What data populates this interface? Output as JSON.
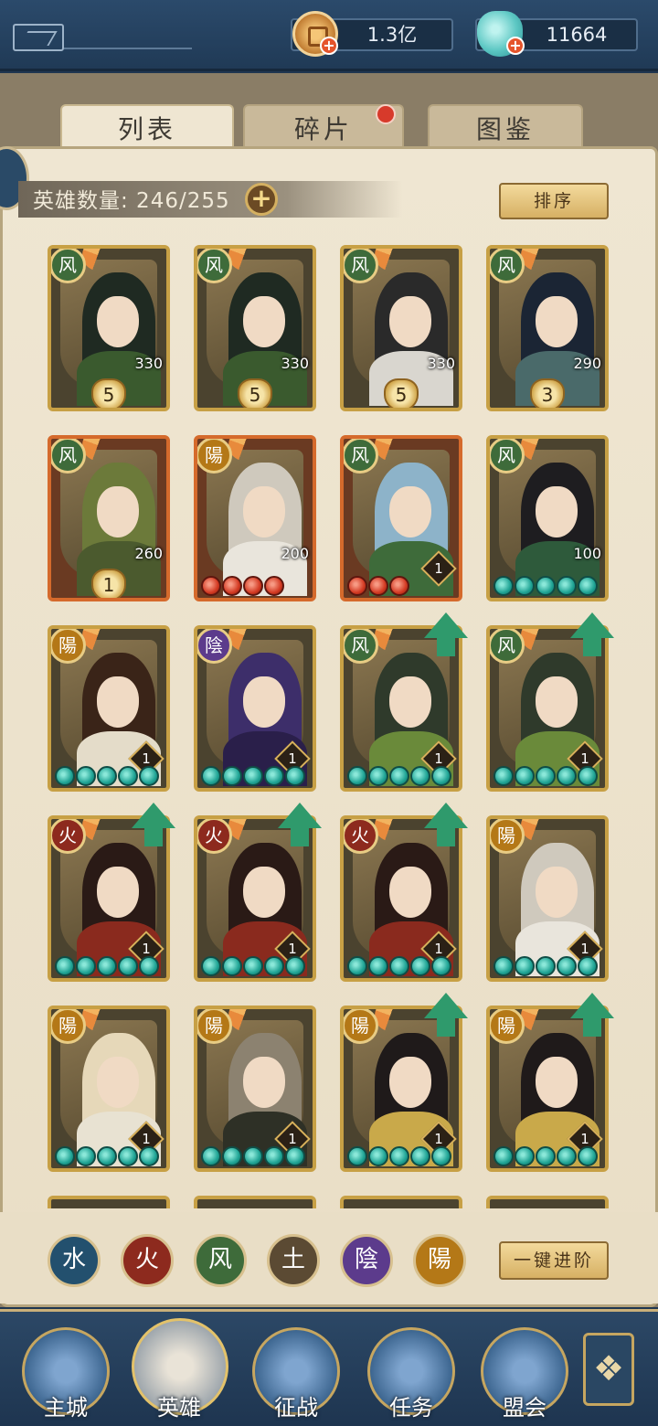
{
  "resources": {
    "coins": "1.3亿",
    "jade": "11664"
  },
  "tabs": [
    {
      "label": "列表",
      "active": true
    },
    {
      "label": "碎片",
      "active": false,
      "has_notification": true
    },
    {
      "label": "图鉴",
      "active": false
    }
  ],
  "hero_count": "英雄数量: 246/255",
  "sort_label": "排序",
  "upgrade_all_label": "一键进阶",
  "heroes": [
    {
      "element": "风",
      "level": "330",
      "stars": "5",
      "color": "gold"
    },
    {
      "element": "风",
      "level": "330",
      "stars": "5",
      "color": "gold"
    },
    {
      "element": "风",
      "level": "330",
      "stars": "5",
      "color": "gold"
    },
    {
      "element": "风",
      "level": "290",
      "stars": "3",
      "color": "gold"
    },
    {
      "element": "风",
      "level": "260",
      "stars": "1",
      "color": "red"
    },
    {
      "element": "陽",
      "level": "200",
      "stars": "",
      "pips": 4,
      "pip_color": "red",
      "color": "red"
    },
    {
      "element": "风",
      "level": "",
      "stars": "",
      "rank": "1",
      "pips": 3,
      "pip_color": "red",
      "color": "red"
    },
    {
      "element": "风",
      "level": "100",
      "stars": "",
      "pips": 5,
      "pip_color": "teal",
      "color": "gold"
    },
    {
      "element": "陽",
      "rank": "1",
      "pips": 5,
      "pip_color": "teal",
      "color": "gold"
    },
    {
      "element": "陰",
      "rank": "1",
      "pips": 5,
      "pip_color": "teal",
      "color": "gold"
    },
    {
      "element": "风",
      "rank": "1",
      "pips": 5,
      "pip_color": "teal",
      "color": "gold",
      "upgrade": true
    },
    {
      "element": "风",
      "rank": "1",
      "pips": 5,
      "pip_color": "teal",
      "color": "gold",
      "upgrade": true
    },
    {
      "element": "火",
      "rank": "1",
      "pips": 5,
      "pip_color": "teal",
      "color": "gold",
      "upgrade": true
    },
    {
      "element": "火",
      "rank": "1",
      "pips": 5,
      "pip_color": "teal",
      "color": "gold",
      "upgrade": true
    },
    {
      "element": "火",
      "rank": "1",
      "pips": 5,
      "pip_color": "teal",
      "color": "gold",
      "upgrade": true
    },
    {
      "element": "陽",
      "rank": "1",
      "pips": 5,
      "pip_color": "teal",
      "color": "gold"
    },
    {
      "element": "陽",
      "rank": "1",
      "pips": 5,
      "pip_color": "teal",
      "color": "gold"
    },
    {
      "element": "陽",
      "rank": "1",
      "pips": 5,
      "pip_color": "teal",
      "color": "gold"
    },
    {
      "element": "陽",
      "rank": "1",
      "pips": 5,
      "pip_color": "teal",
      "color": "gold",
      "upgrade": true
    },
    {
      "element": "陽",
      "rank": "1",
      "pips": 5,
      "pip_color": "teal",
      "color": "gold",
      "upgrade": true
    }
  ],
  "filters": [
    {
      "label": "水",
      "color": "#23506e"
    },
    {
      "label": "火",
      "color": "#8d2a1e"
    },
    {
      "label": "风",
      "color": "#3e6b3a"
    },
    {
      "label": "土",
      "color": "#5b4a33"
    },
    {
      "label": "陰",
      "color": "#5c3b8c"
    },
    {
      "label": "陽",
      "color": "#b47817"
    }
  ],
  "nav": [
    {
      "label": "主城",
      "icon": "castle-icon"
    },
    {
      "label": "英雄",
      "icon": "hero-icon",
      "active": true
    },
    {
      "label": "征战",
      "icon": "battle-icon"
    },
    {
      "label": "任务",
      "icon": "quest-icon"
    },
    {
      "label": "盟会",
      "icon": "guild-icon"
    }
  ],
  "menu_icon": "menu-icon",
  "colors": {
    "accent_gold": "#c79a38",
    "panel_paper": "#efe6d2",
    "nav_blue": "#2c4866"
  }
}
